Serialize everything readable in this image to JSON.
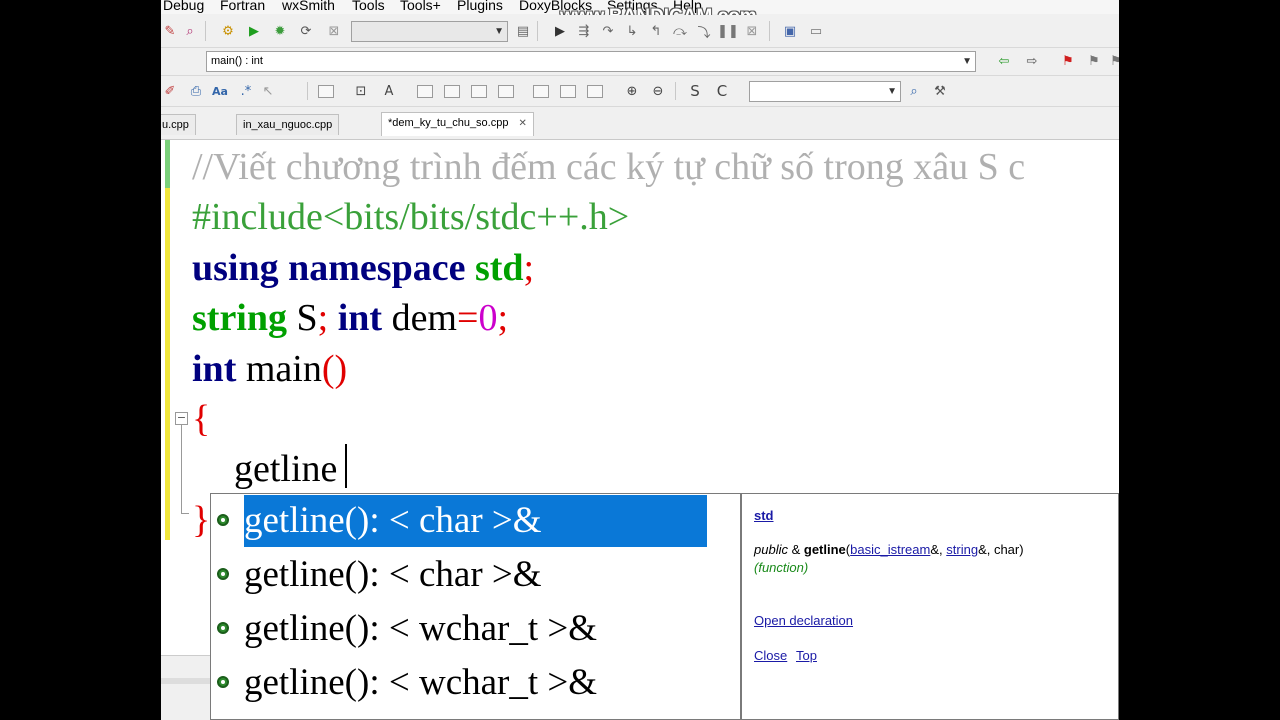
{
  "menu": {
    "items": [
      "Debug",
      "Fortran",
      "wxSmith",
      "Tools",
      "Tools+",
      "Plugins",
      "DoxyBlocks",
      "Settings",
      "Help"
    ],
    "watermark": "www.BANDICAM.com"
  },
  "toolbar": {
    "target_combo": "",
    "scope_combo": "main() : int",
    "search_combo": ""
  },
  "tabs": [
    {
      "label": "u.cpp",
      "active": false
    },
    {
      "label": "in_xau_nguoc.cpp",
      "active": false
    },
    {
      "label": "*dem_ky_tu_chu_so.cpp",
      "active": true
    }
  ],
  "editor": {
    "comment": "//Viết chương trình đếm các ký tự chữ số trong xâu S c",
    "include_hash": "#",
    "include_rest": "include<bits/bits/stdc++.h>",
    "using_kw": "using",
    "namespace_kw": "namespace",
    "std": "std",
    "semicolon": ";",
    "string_kw": "string",
    "var_s": "S",
    "int_kw": "int",
    "var_dem": "dem",
    "eq": "=",
    "zero": "0",
    "main": "main",
    "parens": "()",
    "open_brace": "{",
    "typed": "getline",
    "close_brace": "}"
  },
  "autocomplete": {
    "items": [
      {
        "label": "getline(): < char >&",
        "selected": true
      },
      {
        "label": "getline(): < char >&",
        "selected": false
      },
      {
        "label": "getline(): < wchar_t >&",
        "selected": false
      },
      {
        "label": "getline(): < wchar_t >&",
        "selected": false
      }
    ]
  },
  "doc": {
    "namespace": "std",
    "public": "public",
    "amp": "&",
    "fn_name": "getline",
    "param1": "basic_istream",
    "param1_suffix": "&,",
    "param2": "string",
    "param2_suffix": "&, char)",
    "kind": "(function)",
    "open_declaration": "Open declaration",
    "close": "Close",
    "top": "Top"
  },
  "colors": {
    "selection": "#0a78d7",
    "keyword": "#00007f",
    "type": "#00a000",
    "preprocessor": "#3aa13a",
    "comment": "#b0b0b0",
    "number": "#cc00cc",
    "operator": "#e00000"
  }
}
